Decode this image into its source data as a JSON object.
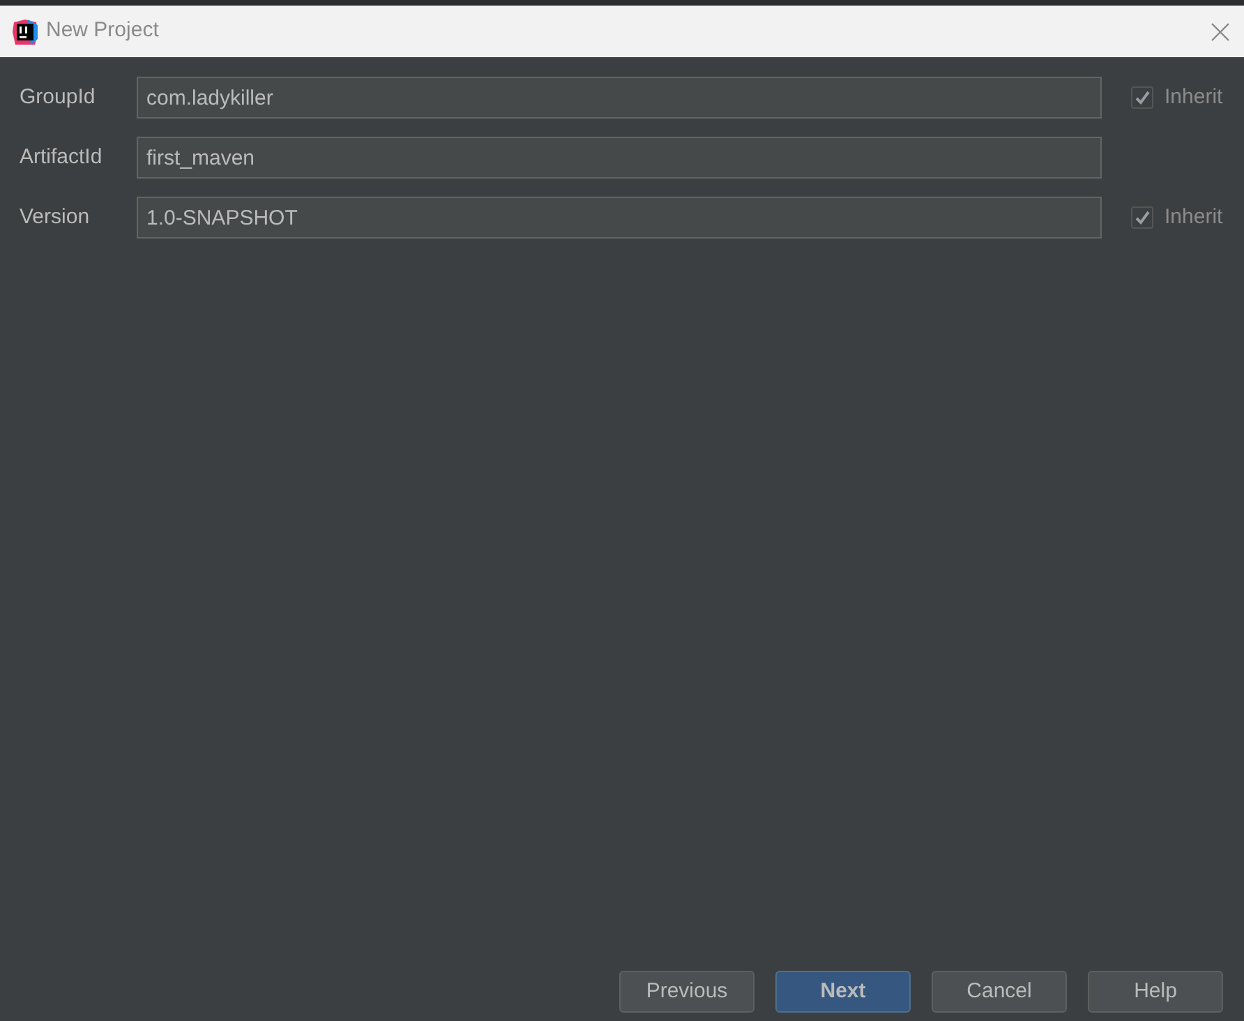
{
  "window": {
    "title": "New Project"
  },
  "fields": [
    {
      "label": "GroupId",
      "value": "com.ladykiller",
      "inherit": {
        "label": "Inherit",
        "checked": true,
        "disabled": true
      }
    },
    {
      "label": "ArtifactId",
      "value": "first_maven"
    },
    {
      "label": "Version",
      "value": "1.0-SNAPSHOT",
      "inherit": {
        "label": "Inherit",
        "checked": true,
        "disabled": true
      }
    }
  ],
  "buttons": [
    {
      "label": "Previous",
      "default": false
    },
    {
      "label": "Next",
      "default": true
    },
    {
      "label": "Cancel",
      "default": false
    },
    {
      "label": "Help",
      "default": false
    }
  ]
}
